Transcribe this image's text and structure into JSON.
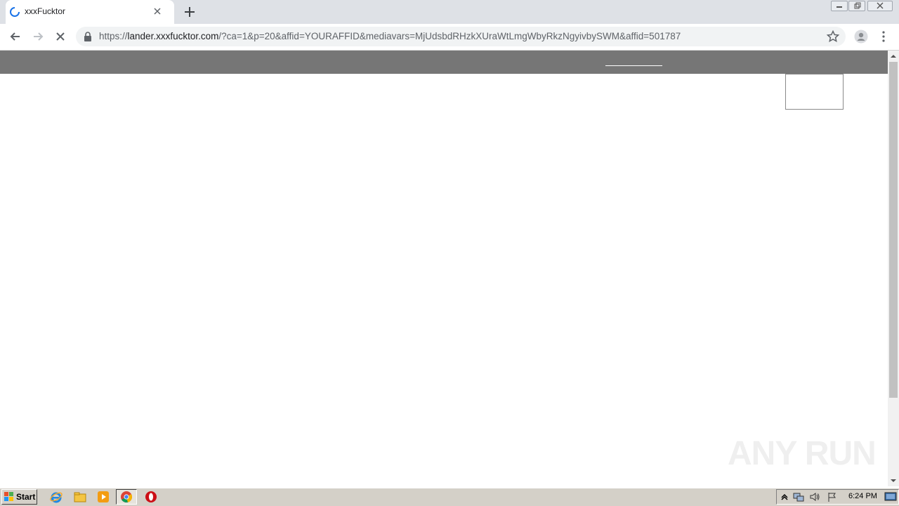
{
  "browser": {
    "tab": {
      "title": "xxxFucktor",
      "state": "loading"
    },
    "address": {
      "scheme": "https://",
      "host": "lander.xxxfucktor.com",
      "path": "/?ca=1&p=20&affid=YOURAFFID&mediavars=MjUdsbdRHzkXUraWtLmgWbyRkzNgyivbySWM&affid=501787"
    }
  },
  "page": {
    "header_color": "#767676"
  },
  "watermark": {
    "text": "ANY RUN"
  },
  "taskbar": {
    "start_label": "Start",
    "clock": "6:24 PM",
    "pinned": [
      "internet-explorer-icon",
      "file-explorer-icon",
      "media-player-icon",
      "chrome-icon",
      "opera-icon"
    ]
  },
  "colors": {
    "tabstrip": "#dee1e6",
    "accent_spinner": "#1a73e8",
    "taskbar": "#d4d0c8"
  }
}
